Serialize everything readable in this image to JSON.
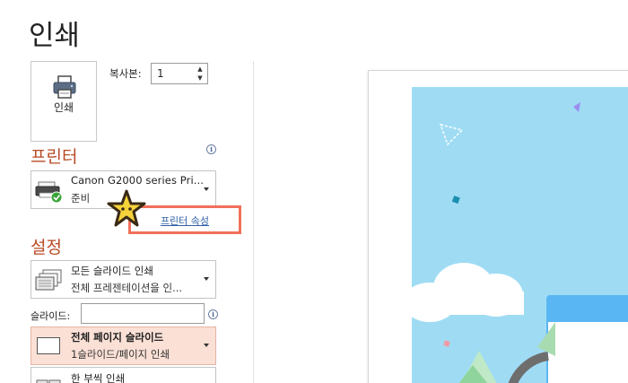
{
  "page": {
    "title": "인쇄"
  },
  "print_button": {
    "label": "인쇄",
    "icon": "printer-icon"
  },
  "copies": {
    "label": "복사본:",
    "value": "1"
  },
  "printer_section": {
    "heading": "프린터",
    "selected": {
      "name": "Canon G2000 series Pri...",
      "status": "준비"
    },
    "properties_link": "프린터 속성"
  },
  "settings_section": {
    "heading": "설정",
    "slides_range": {
      "title": "모든 슬라이드 인쇄",
      "subtitle": "전체 프레젠테이션을 인..."
    },
    "slides_field": {
      "label": "슬라이드:",
      "value": ""
    },
    "layout": {
      "title": "전체 페이지 슬라이드",
      "subtitle": "1슬라이드/페이지 인쇄"
    },
    "collate": {
      "title": "한 부씩 인쇄"
    }
  },
  "colors": {
    "accent": "#b84a24",
    "highlight_box": "#f0705a",
    "link": "#2e62a6",
    "slide_bg": "#9fdcf4",
    "selected_row": "#fbe0d6"
  }
}
